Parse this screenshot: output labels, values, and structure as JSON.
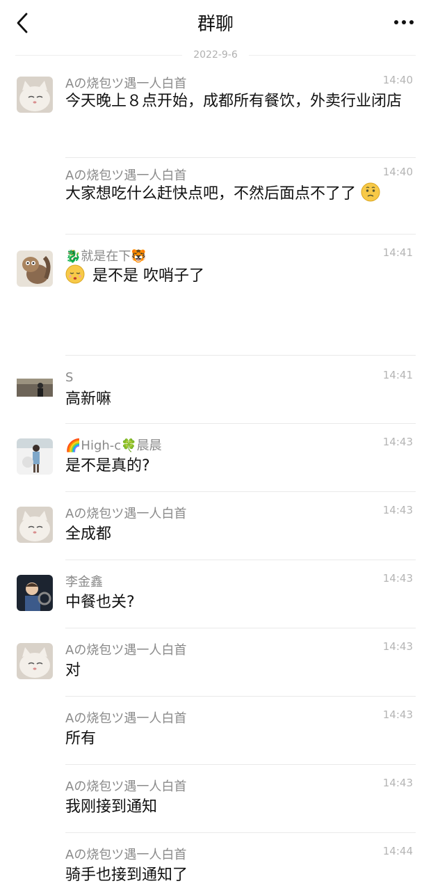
{
  "header": {
    "title": "群聊",
    "back_icon": "chevron-left-icon",
    "more_icon": "more-dots-icon"
  },
  "date_divider": "2022-9-6",
  "messages": [
    {
      "sender": "Aの烧包ツ遇一人白首",
      "time": "14:40",
      "text": "今天晚上８点开始，成都所有餐饮，外卖行业闭店",
      "avatar": "cat"
    },
    {
      "sender": "Aの烧包ツ遇一人白首",
      "time": "14:40",
      "text": "大家想吃什么赶快点吧，不然后面点不了了",
      "emoji_after": "puzzled-face-emoji"
    },
    {
      "sender_prefix_icon": "dragon-emoji",
      "sender": "就是在下",
      "sender_suffix_icon": "tiger-face-emoji",
      "time": "14:41",
      "text": "是不是 吹哨子了",
      "emoji_before": "whistling-face-emoji",
      "avatar": "cartoon-squirrel"
    },
    {
      "sender": "S",
      "time": "14:41",
      "text": "高新嘛",
      "avatar": "person-photo"
    },
    {
      "sender_prefix_icon": "rainbow-emoji",
      "sender": "High-c",
      "sender_suffix_icon": "clover-emoji",
      "sender_suffix_text": "晨晨",
      "time": "14:43",
      "text": "是不是真的?",
      "avatar": "girl-photo"
    },
    {
      "sender": "Aの烧包ツ遇一人白首",
      "time": "14:43",
      "text": "全成都",
      "avatar": "cat"
    },
    {
      "sender": "李金鑫",
      "time": "14:43",
      "text": "中餐也关?",
      "avatar": "driver-photo"
    },
    {
      "sender": "Aの烧包ツ遇一人白首",
      "time": "14:43",
      "text": "对",
      "avatar": "cat"
    },
    {
      "sender": "Aの烧包ツ遇一人白首",
      "time": "14:43",
      "text": "所有"
    },
    {
      "sender": "Aの烧包ツ遇一人白首",
      "time": "14:43",
      "text": "我刚接到通知"
    },
    {
      "sender": "Aの烧包ツ遇一人白首",
      "time": "14:44",
      "text": "骑手也接到通知了"
    }
  ]
}
